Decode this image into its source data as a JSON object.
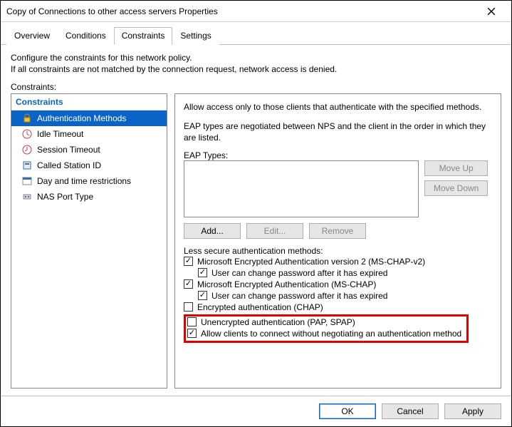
{
  "window": {
    "title": "Copy of Connections to other access servers Properties"
  },
  "tabs": {
    "overview": "Overview",
    "conditions": "Conditions",
    "constraints": "Constraints",
    "settings": "Settings"
  },
  "desc": {
    "line1": "Configure the constraints for this network policy.",
    "line2": "If all constraints are not matched by the connection request, network access is denied."
  },
  "labels": {
    "constraints": "Constraints:",
    "eap_types": "EAP Types:",
    "less_secure": "Less secure authentication methods:"
  },
  "tree": {
    "header": "Constraints",
    "items": [
      {
        "label": "Authentication Methods"
      },
      {
        "label": "Idle Timeout"
      },
      {
        "label": "Session Timeout"
      },
      {
        "label": "Called Station ID"
      },
      {
        "label": "Day and time restrictions"
      },
      {
        "label": "NAS Port Type"
      }
    ]
  },
  "detail": {
    "intro1": "Allow access only to those clients that authenticate with the specified methods.",
    "intro2": "EAP types are negotiated between NPS and the client in the order in which they are listed."
  },
  "buttons": {
    "moveup": "Move Up",
    "movedown": "Move Down",
    "add": "Add...",
    "edit": "Edit...",
    "remove": "Remove",
    "ok": "OK",
    "cancel": "Cancel",
    "apply": "Apply"
  },
  "checks": {
    "mschap2": {
      "label": "Microsoft Encrypted Authentication version 2 (MS-CHAP-v2)",
      "checked": true
    },
    "mschap2_exp": {
      "label": "User can change password after it has expired",
      "checked": true
    },
    "mschap": {
      "label": "Microsoft Encrypted Authentication (MS-CHAP)",
      "checked": true
    },
    "mschap_exp": {
      "label": "User can change password after it has expired",
      "checked": true
    },
    "chap": {
      "label": "Encrypted authentication (CHAP)",
      "checked": false
    },
    "pap": {
      "label": "Unencrypted authentication (PAP, SPAP)",
      "checked": false
    },
    "noauth": {
      "label": "Allow clients to connect without negotiating an authentication method",
      "checked": true
    }
  }
}
